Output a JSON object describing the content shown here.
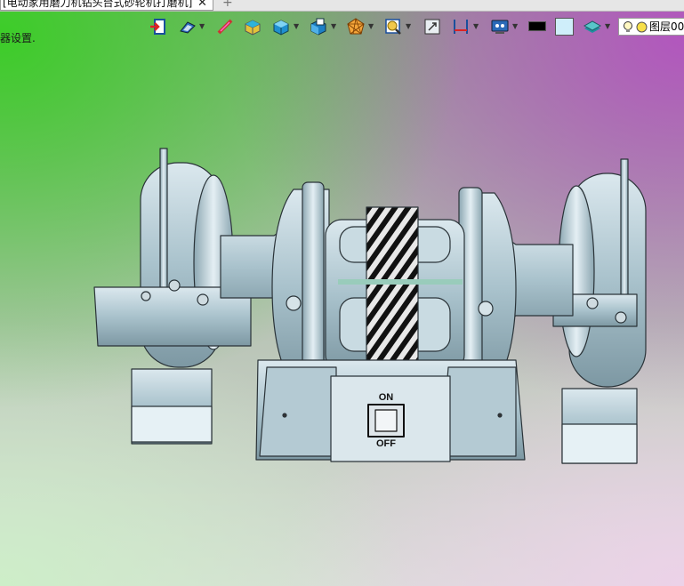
{
  "document_tab": {
    "title": "[电动家用磨刀机钻头台式砂轮机打磨机]",
    "close_glyph": "✕",
    "add_glyph": "+"
  },
  "status_text": "器设置.",
  "toolbar": {
    "icons": [
      "exit-icon",
      "view-orientation-icon",
      "measure-icon",
      "shaded-box-icon",
      "shaded-cube-icon",
      "view-cube-icon",
      "render-mode-icon",
      "section-view-icon",
      "zoom-fit-icon",
      "dimension-icon",
      "display-settings-icon"
    ]
  },
  "colors": {
    "foreground_swatch": "#000000",
    "background_swatch": "#cfeefa",
    "model_body": "#b8cfd8",
    "model_edge": "#2a3338"
  },
  "layer": {
    "label": "图层00"
  },
  "model": {
    "switch_on": "ON",
    "switch_off": "OFF"
  }
}
